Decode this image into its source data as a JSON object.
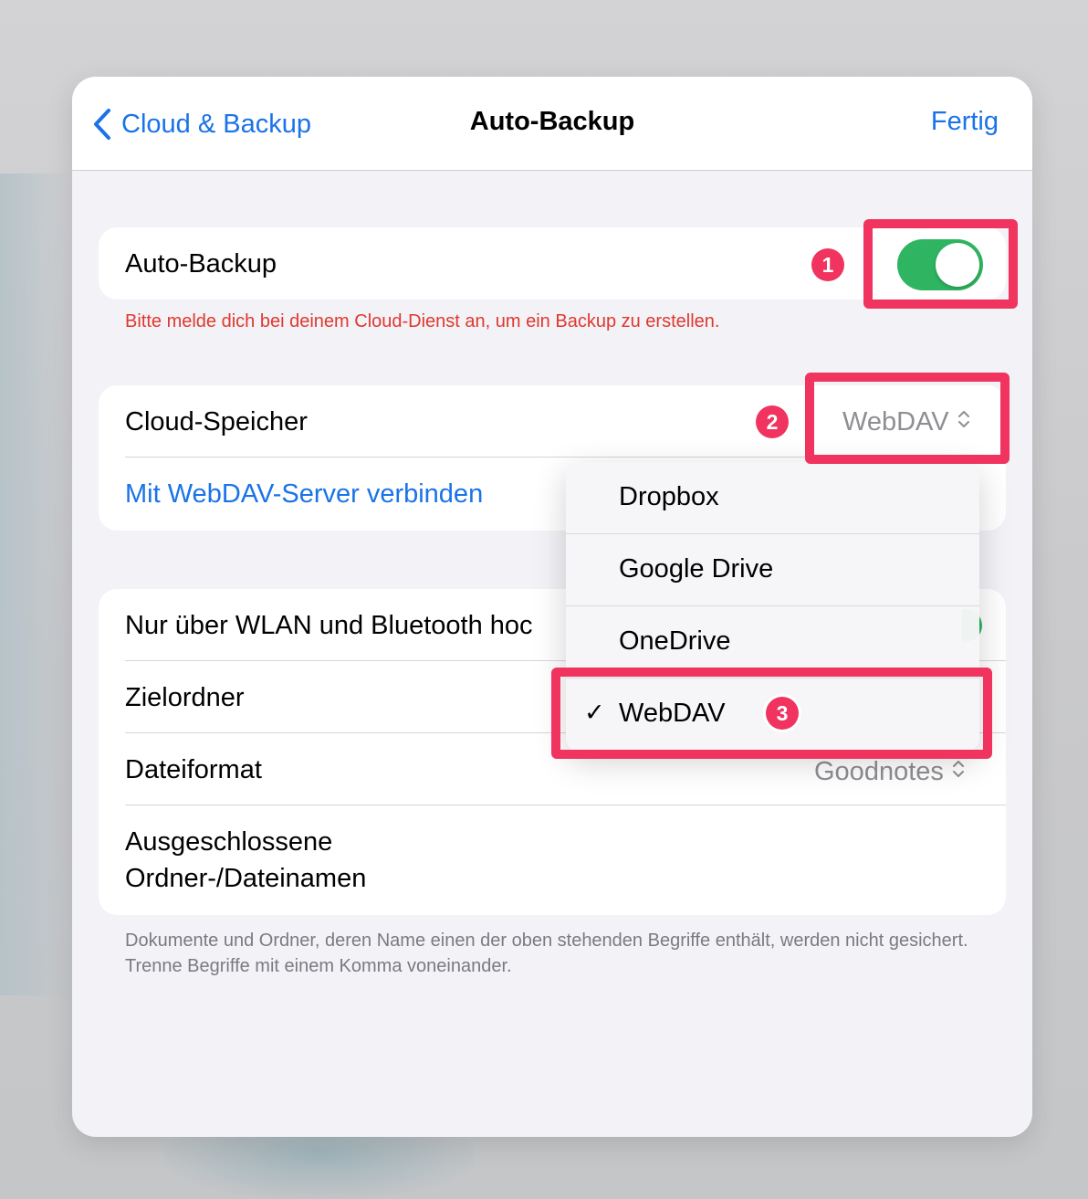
{
  "navbar": {
    "back_label": "Cloud & Backup",
    "title": "Auto-Backup",
    "done_label": "Fertig"
  },
  "auto_backup": {
    "label": "Auto-Backup",
    "enabled": true,
    "warning": "Bitte melde dich bei deinem Cloud-Dienst an, um ein Backup zu erstellen."
  },
  "cloud": {
    "storage_label": "Cloud-Speicher",
    "storage_value": "WebDAV",
    "connect_label": "Mit WebDAV-Server verbinden"
  },
  "settings": {
    "wifi_label": "Nur über WLAN und Bluetooth hoc",
    "target_folder_label": "Zielordner",
    "file_format_label": "Dateiformat",
    "file_format_value": "Goodnotes",
    "excluded_line1": "Ausgeschlossene",
    "excluded_line2": "Ordner-/Dateinamen",
    "excluded_note": "Dokumente und Ordner, deren Name einen der oben stehenden Begriffe enthält, werden nicht gesichert. Trenne Begriffe mit einem Komma voneinander."
  },
  "dropdown": {
    "items": [
      {
        "label": "Dropbox",
        "selected": false
      },
      {
        "label": "Google Drive",
        "selected": false
      },
      {
        "label": "OneDrive",
        "selected": false
      },
      {
        "label": "WebDAV",
        "selected": true
      }
    ],
    "check_glyph": "✓"
  },
  "markers": [
    "1",
    "2",
    "3"
  ],
  "colors": {
    "accent": "#1a73e8",
    "toggle_on": "#2fb561",
    "warning": "#e0382e",
    "annotation": "#f0335f"
  }
}
